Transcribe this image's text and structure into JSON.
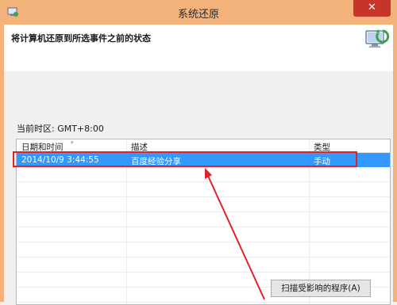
{
  "window": {
    "title": "系统还原",
    "close_glyph": "✕"
  },
  "header": {
    "title": "将计算机还原到所选事件之前的状态",
    "icon": "system-restore-icon"
  },
  "timezone_label": "当前时区: GMT+8:00",
  "list": {
    "columns": [
      "日期和时间",
      "描述",
      "类型"
    ],
    "rows": [
      {
        "date": "2014/10/9 3:44:55",
        "description": "百度经验分享",
        "type": "手动",
        "selected": true
      }
    ]
  },
  "buttons": {
    "scan_label": "扫描受影响的程序(A)"
  },
  "colors": {
    "titlebar": "#f2b27a",
    "selection": "#3399ff",
    "annotation_red": "#e0222a",
    "close": "#c7342a"
  }
}
